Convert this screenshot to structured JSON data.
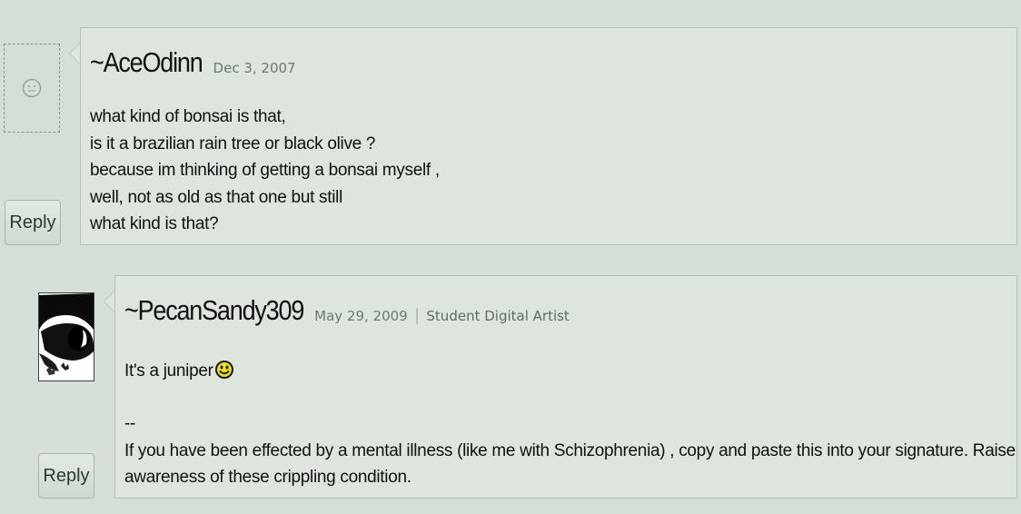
{
  "comments": [
    {
      "username": "~AceOdinn",
      "date": "Dec 3, 2007",
      "lines": [
        "what kind of bonsai is that,",
        "is it a brazilian rain tree or black olive ?",
        "because im thinking of getting a bonsai myself ,",
        "well, not as old as that one but still",
        "what kind is that?"
      ],
      "reply_label": "Reply",
      "avatar": "placeholder-face-icon"
    },
    {
      "username": "~PecanSandy309",
      "date": "May 29, 2009",
      "role": "Student Digital Artist",
      "text": "It's a juniper",
      "emoticon": "smiley-icon",
      "signature_separator": "--",
      "signature_lines": [
        "If you have been effected by a mental illness (like me with Schizophrenia) , copy and paste this into your signature. Raise",
        "awareness of these crippling condition."
      ],
      "reply_label": "Reply",
      "avatar": "eye-drawing-avatar"
    }
  ],
  "colors": {
    "background": "#d6dfd7",
    "comment_bg": "#dde5dd",
    "border": "#b4beb5",
    "date_text": "#6c7a6d",
    "smiley_yellow": "#e8e020"
  }
}
